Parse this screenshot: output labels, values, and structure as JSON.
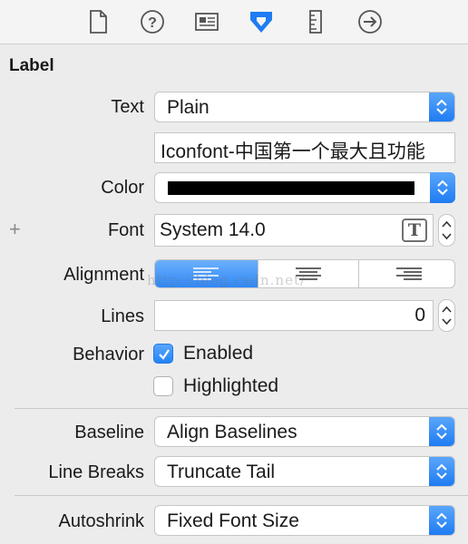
{
  "toolbar": {
    "tabs": [
      {
        "icon": "file-icon"
      },
      {
        "icon": "help-icon"
      },
      {
        "icon": "identity-icon"
      },
      {
        "icon": "attributes-icon",
        "active": true
      },
      {
        "icon": "size-ruler-icon"
      },
      {
        "icon": "connections-arrow-icon"
      }
    ],
    "active_color": "#1f7cf2"
  },
  "section": {
    "title": "Label"
  },
  "text": {
    "label": "Text",
    "mode": "Plain",
    "value": "Iconfont-中国第一个最大且功能"
  },
  "color": {
    "label": "Color",
    "swatch": "#000000"
  },
  "font": {
    "label": "Font",
    "value": "System 14.0",
    "t_button": "T"
  },
  "alignment": {
    "label": "Alignment",
    "selected": "left",
    "options": [
      "left",
      "center",
      "right"
    ]
  },
  "watermark": "http://blog.csdn.net/",
  "lines": {
    "label": "Lines",
    "value": "0"
  },
  "behavior": {
    "label": "Behavior",
    "enabled": {
      "label": "Enabled",
      "checked": true
    },
    "highlighted": {
      "label": "Highlighted",
      "checked": false
    }
  },
  "baseline": {
    "label": "Baseline",
    "value": "Align Baselines"
  },
  "line_breaks": {
    "label": "Line Breaks",
    "value": "Truncate Tail"
  },
  "autoshrink": {
    "label": "Autoshrink",
    "value": "Fixed Font Size"
  }
}
